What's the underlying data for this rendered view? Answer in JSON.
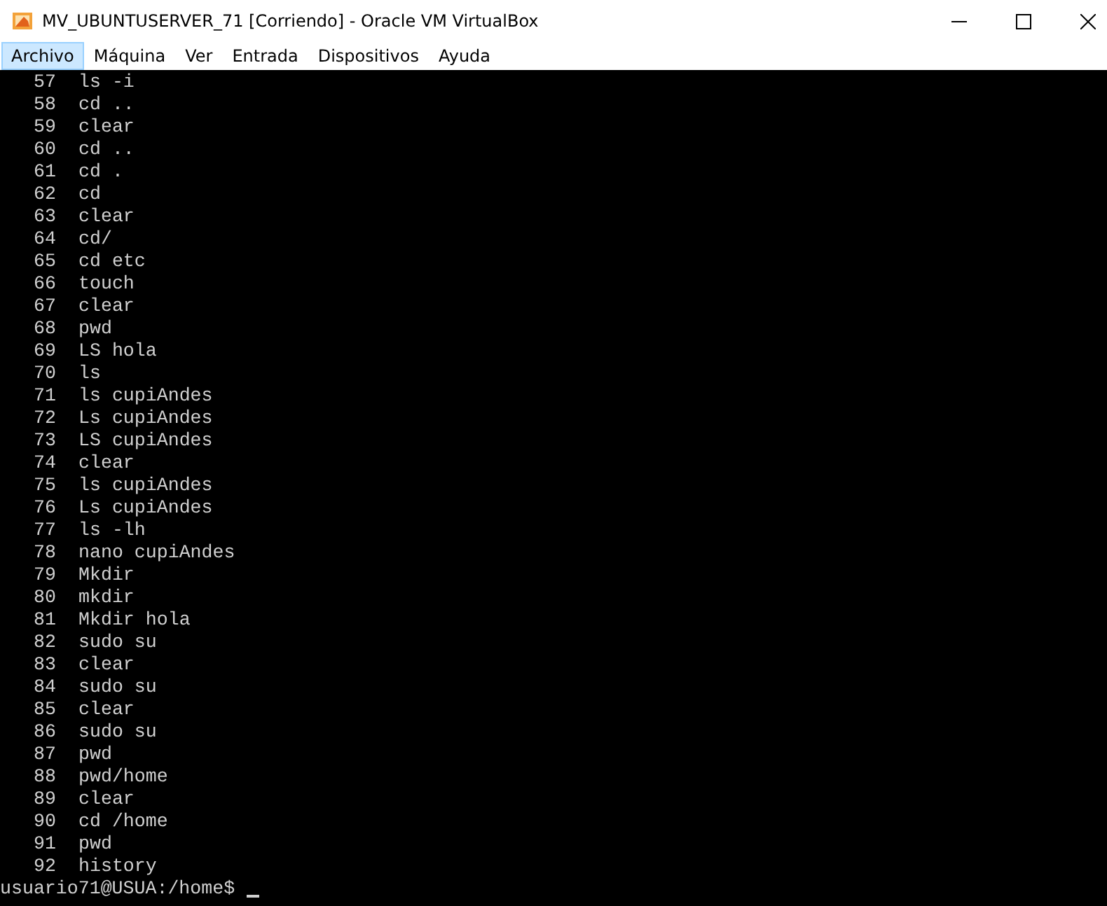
{
  "window": {
    "title": "MV_UBUNTUSERVER_71 [Corriendo] - Oracle VM VirtualBox"
  },
  "menu": [
    {
      "label": "Archivo",
      "selected": true
    },
    {
      "label": "Máquina",
      "selected": false
    },
    {
      "label": "Ver",
      "selected": false
    },
    {
      "label": "Entrada",
      "selected": false
    },
    {
      "label": "Dispositivos",
      "selected": false
    },
    {
      "label": "Ayuda",
      "selected": false
    }
  ],
  "terminal": {
    "history": [
      {
        "number": "57",
        "command": "ls -i"
      },
      {
        "number": "58",
        "command": "cd .."
      },
      {
        "number": "59",
        "command": "clear"
      },
      {
        "number": "60",
        "command": "cd .."
      },
      {
        "number": "61",
        "command": "cd ."
      },
      {
        "number": "62",
        "command": "cd"
      },
      {
        "number": "63",
        "command": "clear"
      },
      {
        "number": "64",
        "command": "cd/"
      },
      {
        "number": "65",
        "command": "cd etc"
      },
      {
        "number": "66",
        "command": "touch"
      },
      {
        "number": "67",
        "command": "clear"
      },
      {
        "number": "68",
        "command": "pwd"
      },
      {
        "number": "69",
        "command": "LS hola"
      },
      {
        "number": "70",
        "command": "ls"
      },
      {
        "number": "71",
        "command": "ls cupiAndes"
      },
      {
        "number": "72",
        "command": "Ls cupiAndes"
      },
      {
        "number": "73",
        "command": "LS cupiAndes"
      },
      {
        "number": "74",
        "command": "clear"
      },
      {
        "number": "75",
        "command": "ls cupiAndes"
      },
      {
        "number": "76",
        "command": "Ls cupiAndes"
      },
      {
        "number": "77",
        "command": "ls -lh"
      },
      {
        "number": "78",
        "command": "nano cupiAndes"
      },
      {
        "number": "79",
        "command": "Mkdir"
      },
      {
        "number": "80",
        "command": "mkdir"
      },
      {
        "number": "81",
        "command": "Mkdir hola"
      },
      {
        "number": "82",
        "command": "sudo su"
      },
      {
        "number": "83",
        "command": "clear"
      },
      {
        "number": "84",
        "command": "sudo su"
      },
      {
        "number": "85",
        "command": "clear"
      },
      {
        "number": "86",
        "command": "sudo su"
      },
      {
        "number": "87",
        "command": "pwd"
      },
      {
        "number": "88",
        "command": "pwd/home"
      },
      {
        "number": "89",
        "command": "clear"
      },
      {
        "number": "90",
        "command": "cd /home"
      },
      {
        "number": "91",
        "command": "pwd"
      },
      {
        "number": "92",
        "command": "history"
      }
    ],
    "prompt": "usuario71@USUA:/home$"
  }
}
